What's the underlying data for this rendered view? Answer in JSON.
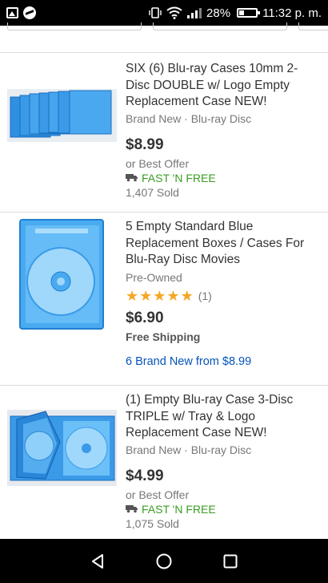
{
  "status_bar": {
    "battery": "28%",
    "battery_level": 0.28,
    "time": "11:32 p. m."
  },
  "listings": [
    {
      "title": "SIX (6) Blu-ray Cases 10mm 2-Disc DOUBLE w/ Logo Empty Replacement Case NEW!",
      "subtitle": "Brand New · Blu-ray Disc",
      "price": "$8.99",
      "offer": "or Best Offer",
      "shipping": "FAST 'N FREE",
      "sold": "1,407 Sold"
    },
    {
      "title": "5 Empty Standard Blue Replacement Boxes / Cases For Blu-Ray Disc Movies",
      "subtitle": "Pre-Owned",
      "rating": 5,
      "rating_count": "(1)",
      "price": "$6.90",
      "shipping": "Free Shipping",
      "more": "6 Brand New from $8.99"
    },
    {
      "title": "(1) Empty Blu-ray Case 3-Disc TRIPLE w/ Tray & Logo Replacement Case NEW!",
      "subtitle": "Brand New · Blu-ray Disc",
      "price": "$4.99",
      "offer": "or Best Offer",
      "shipping": "FAST 'N FREE",
      "sold": "1,075 Sold"
    }
  ],
  "colors": {
    "link": "#0654ba",
    "fast_free": "#3a9d23",
    "stars": "#f5a623",
    "case_blue": "#3aa0e8"
  }
}
